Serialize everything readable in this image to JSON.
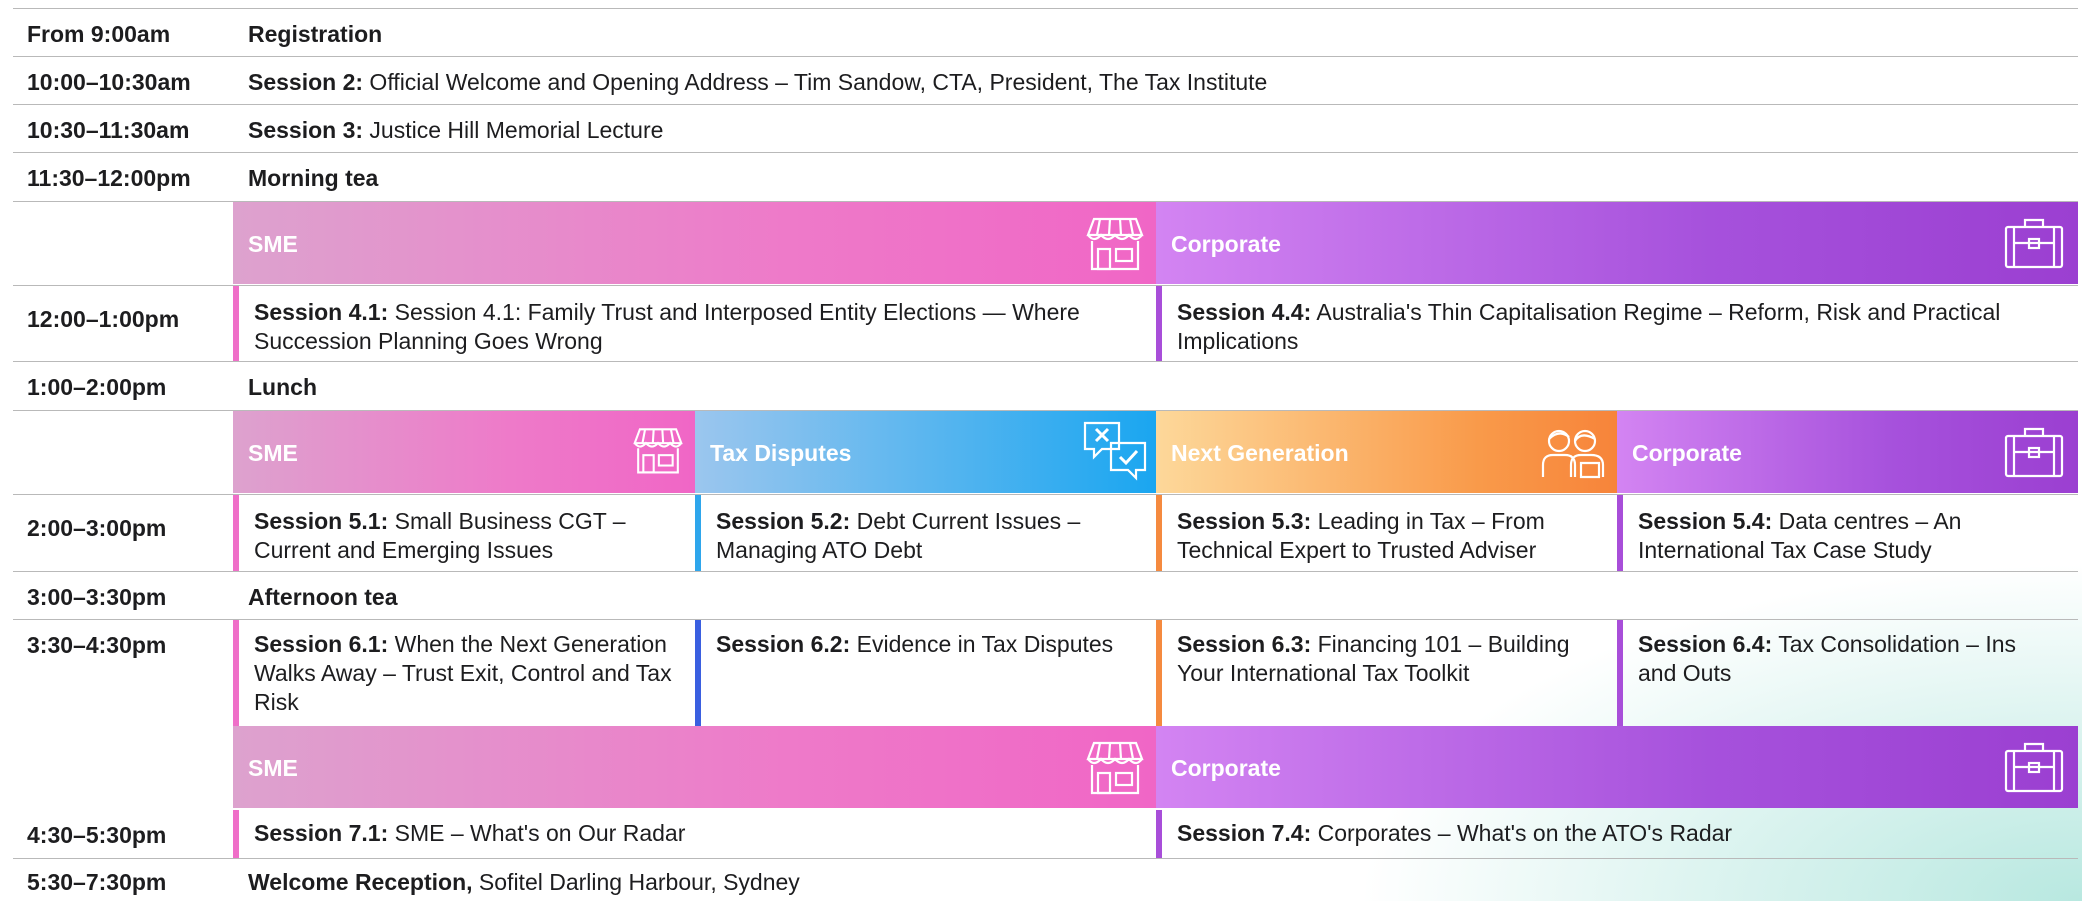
{
  "rows": [
    {
      "time": "From 9:00am",
      "label": "Registration"
    },
    {
      "time": "10:00–10:30am",
      "bold": "Session 2:",
      "text": " Official Welcome and Opening Address – Tim Sandow, CTA, President, The Tax Institute"
    },
    {
      "time": "10:30–11:30am",
      "bold": "Session 3:",
      "text": " Justice Hill Memorial Lecture"
    },
    {
      "time": "11:30–12:00pm",
      "label": "Morning tea"
    },
    {
      "time": "1:00–2:00pm",
      "label": "Lunch"
    },
    {
      "time": "3:00–3:30pm",
      "label": "Afternoon tea"
    },
    {
      "time": "5:30–7:30pm",
      "bold": "Welcome Reception,",
      "text": " Sofitel Darling Harbour, Sydney"
    }
  ],
  "block4": {
    "time": "12:00–1:00pm",
    "streams": [
      "SME",
      "Corporate"
    ],
    "sessions": [
      {
        "id": "Session 4.1:",
        "title": " Session 4.1: Family Trust and Interposed Entity Elections — Where Succession Planning Goes Wrong"
      },
      {
        "id": "Session 4.4:",
        "title": " Australia's Thin Capitalisation Regime – Reform, Risk and Practical Implications"
      }
    ]
  },
  "block5": {
    "time": "2:00–3:00pm",
    "streams": [
      "SME",
      "Tax Disputes",
      "Next Generation",
      "Corporate"
    ],
    "sessions": [
      {
        "id": "Session 5.1:",
        "title": " Small Business CGT – Current and Emerging Issues"
      },
      {
        "id": "Session 5.2:",
        "title": " Debt Current Issues – Managing ATO Debt"
      },
      {
        "id": "Session 5.3:",
        "title": " Leading in Tax – From Technical Expert to Trusted Adviser"
      },
      {
        "id": "Session 5.4:",
        "title": " Data centres – An International Tax Case Study"
      }
    ]
  },
  "block6": {
    "time": "3:30–4:30pm",
    "sessions": [
      {
        "id": "Session 6.1:",
        "title": " When the Next Generation Walks Away – Trust Exit, Control and Tax Risk"
      },
      {
        "id": "Session 6.2:",
        "title": " Evidence in Tax Disputes"
      },
      {
        "id": "Session 6.3:",
        "title": " Financing 101 – Building Your International Tax Toolkit"
      },
      {
        "id": "Session 6.4:",
        "title": " Tax Consolidation – Ins and Outs"
      }
    ]
  },
  "block7": {
    "time": "4:30–5:30pm",
    "streams": [
      "SME",
      "Corporate"
    ],
    "sessions": [
      {
        "id": "Session 7.1:",
        "title": " SME – What's on Our Radar"
      },
      {
        "id": "Session 7.4:",
        "title": " Corporates – What's on the ATO's Radar"
      }
    ]
  },
  "colors": {
    "sme": "#ef6fc8",
    "corporate": "#a84ed9",
    "tax_disputes": "#2ea6ec",
    "next_generation": "#f58a3f"
  },
  "icons": {
    "sme": "shop-icon",
    "corporate": "briefcase-icon",
    "tax_disputes": "speech-bubbles-icon",
    "next_generation": "people-icon"
  }
}
